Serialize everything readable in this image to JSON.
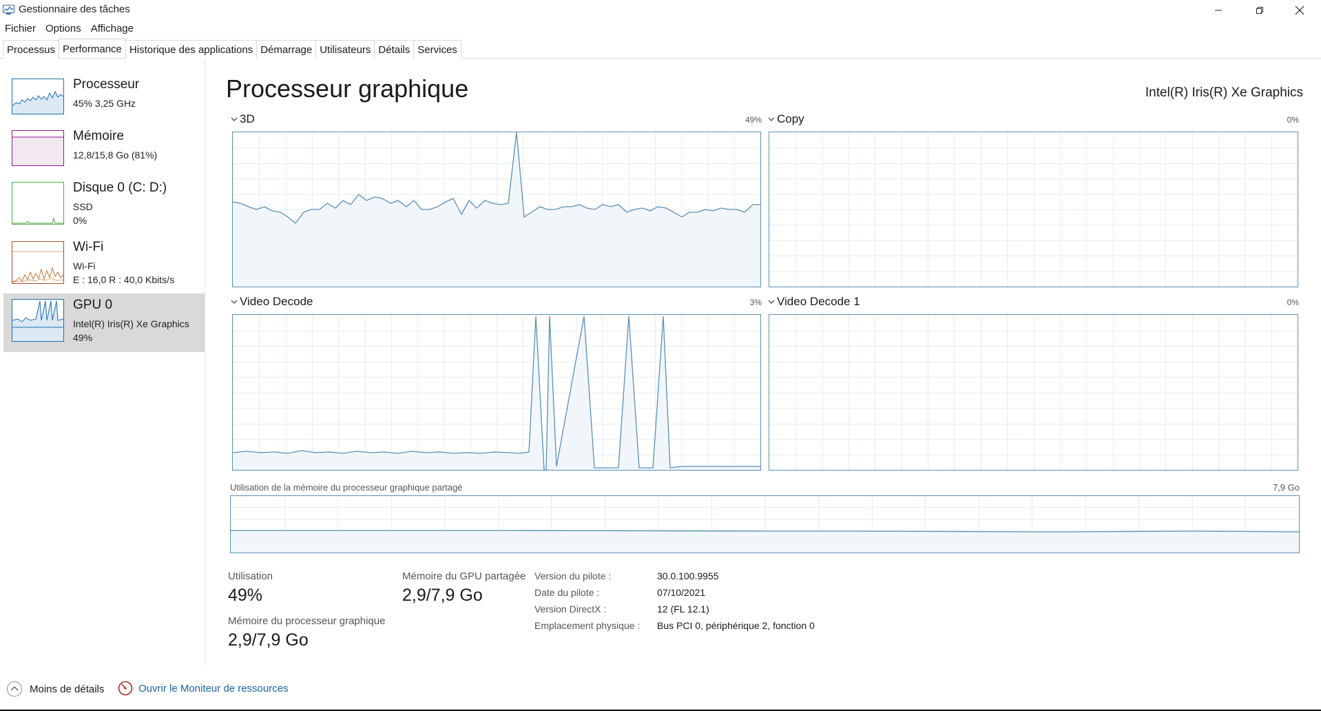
{
  "window": {
    "title": "Gestionnaire des tâches"
  },
  "menu": [
    "Fichier",
    "Options",
    "Affichage"
  ],
  "tabs": [
    "Processus",
    "Performance",
    "Historique des applications",
    "Démarrage",
    "Utilisateurs",
    "Détails",
    "Services"
  ],
  "active_tab": "Performance",
  "sidebar": {
    "items": [
      {
        "title": "Processeur",
        "sub1": "45% 3,25 GHz",
        "sub2": "",
        "color": "#1b6fab"
      },
      {
        "title": "Mémoire",
        "sub1": "12,8/15,8 Go (81%)",
        "sub2": "",
        "color": "#8b1a8b"
      },
      {
        "title": "Disque 0 (C: D:)",
        "sub1": "SSD",
        "sub2": "0%",
        "color": "#4ca84c"
      },
      {
        "title": "Wi-Fi",
        "sub1": "Wi-Fi",
        "sub2": "E : 16,0  R : 40,0 Kbits/s",
        "color": "#a0522d"
      },
      {
        "title": "GPU 0",
        "sub1": "Intel(R) Iris(R) Xe Graphics",
        "sub2": "49%",
        "color": "#1b6fab"
      }
    ]
  },
  "main": {
    "title": "Processeur graphique",
    "device": "Intel(R) Iris(R) Xe Graphics",
    "graphs": [
      {
        "name": "3D",
        "percent": "49%"
      },
      {
        "name": "Copy",
        "percent": "0%"
      },
      {
        "name": "Video Decode",
        "percent": "3%"
      },
      {
        "name": "Video Decode 1",
        "percent": "0%"
      }
    ],
    "shared_memory": {
      "label": "Utilisation de la mémoire du processeur graphique partagé",
      "max": "7,9 Go"
    },
    "stats": {
      "utilization_label": "Utilisation",
      "utilization_value": "49%",
      "shared_label": "Mémoire du GPU partagée",
      "shared_value": "2,9/7,9 Go",
      "gpu_mem_label": "Mémoire du processeur graphique",
      "gpu_mem_value": "2,9/7,9 Go"
    },
    "info": [
      {
        "key": "Version du pilote :",
        "value": "30.0.100.9955"
      },
      {
        "key": "Date du pilote :",
        "value": "07/10/2021"
      },
      {
        "key": "Version DirectX :",
        "value": "12 (FL 12.1)"
      },
      {
        "key": "Emplacement physique :",
        "value": "Bus PCI 0, périphérique 2, fonction 0"
      }
    ]
  },
  "footer": {
    "less_details": "Moins de détails",
    "resource_monitor": "Ouvrir le Moniteur de ressources"
  },
  "colors": {
    "gpu_line": "#5a8fb4",
    "gpu_fill": "#f1f6fa",
    "grid": "#e4edf3"
  }
}
